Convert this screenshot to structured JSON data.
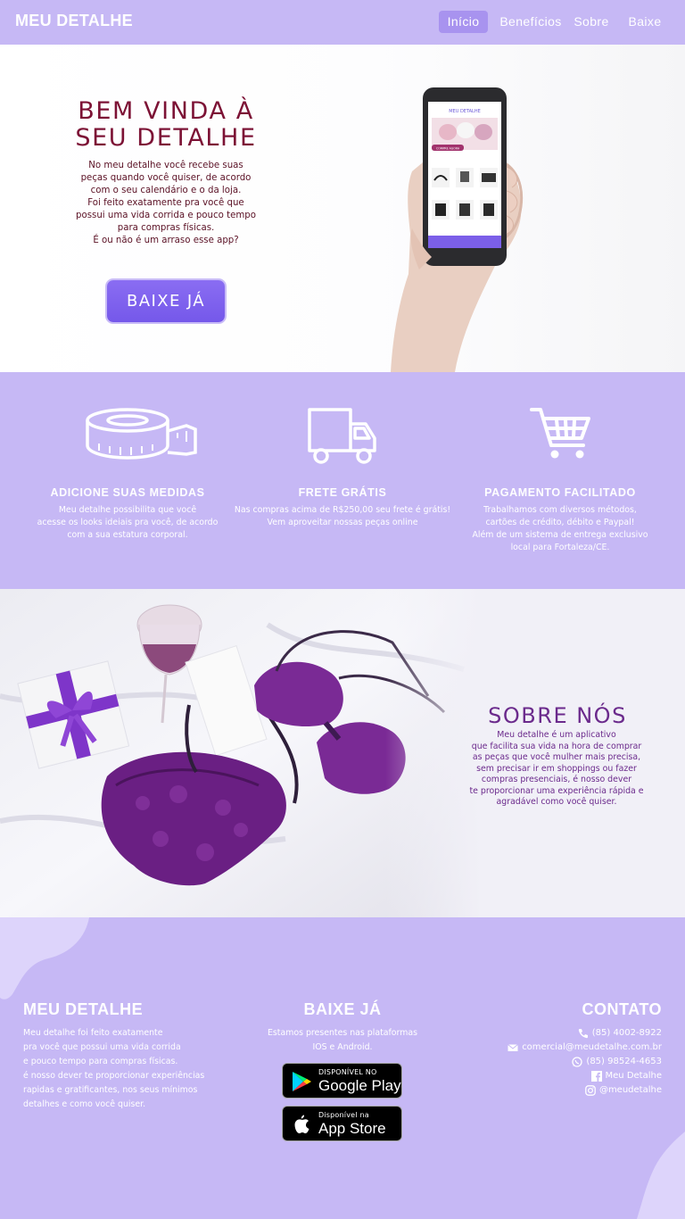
{
  "nav": {
    "brand": "MEU DETALHE",
    "links": [
      "Início",
      "Benefícios",
      "Sobre",
      "Baixe"
    ],
    "active_index": 0
  },
  "hero": {
    "title": "BEM VINDA À SEU DETALHE",
    "text_lines": [
      "No meu detalhe você recebe suas",
      "peças quando você quiser, de acordo",
      "com o seu calendário e o da loja.",
      "Foi feito exatamente pra você que",
      "possui uma vida corrida e pouco tempo",
      "para compras físicas.",
      "É ou não é um arraso esse app?"
    ],
    "cta": "BAIXE JÁ",
    "phone_screen": {
      "header": "MEU DETALHE",
      "banner_button": "COMPRE AGORA"
    }
  },
  "features": [
    {
      "icon": "measuring-tape-icon",
      "title": "ADICIONE SUAS MEDIDAS",
      "lines": [
        "Meu detalhe possibilita que você",
        "acesse os looks ideiais pra você, de acordo",
        "com a sua estatura corporal."
      ]
    },
    {
      "icon": "delivery-truck-icon",
      "title": "FRETE GRÁTIS",
      "lines": [
        "Nas compras acima de R$250,00 seu frete é grátis!",
        "Vem aproveitar nossas peças online"
      ]
    },
    {
      "icon": "shopping-cart-icon",
      "title": "PAGAMENTO FACILITADO",
      "lines": [
        "Trabalhamos com diversos métodos,",
        "cartões de crédito, débito e Paypal!",
        "Além de um sistema de entrega exclusivo",
        "local para Fortaleza/CE."
      ]
    }
  ],
  "about": {
    "title": "SOBRE NÓS",
    "lines": [
      "Meu detalhe é um aplicativo",
      "que facilita sua vida na hora de comprar",
      "as peças que você mulher mais precisa,",
      "sem precisar ir em shoppings ou fazer",
      "compras presenciais, é nosso dever",
      "te proporcionar uma experiência rápida e",
      "agradável como você quiser."
    ]
  },
  "footer": {
    "col1": {
      "title": "MEU DETALHE",
      "lines": [
        "Meu detalhe foi feito exatamente",
        "pra você que possui uma vida corrida",
        "e pouco tempo para compras físicas.",
        "é nosso dever te proporcionar experiências",
        "rapidas e gratificantes, nos seus mínimos",
        "detalhes e como você quiser."
      ]
    },
    "col2": {
      "title": "BAIXE JÁ",
      "lines": [
        "Estamos presentes nas plataformas",
        "IOS e Android."
      ],
      "google_play": {
        "small": "DISPONÍVEL NO",
        "big": "Google Play"
      },
      "app_store": {
        "small": "Disponível na",
        "big": "App Store"
      }
    },
    "col3": {
      "title": "CONTATO",
      "rows": [
        {
          "icon": "phone-icon",
          "text": "(85) 4002-8922"
        },
        {
          "icon": "mail-icon",
          "text": "comercial@meudetalhe.com.br"
        },
        {
          "icon": "whatsapp-icon",
          "text": "(85) 98524-4653"
        },
        {
          "icon": "facebook-icon",
          "text": "Meu Detalhe"
        },
        {
          "icon": "instagram-icon",
          "text": "@meudetalhe"
        }
      ]
    }
  },
  "colors": {
    "lavender": "#c6b8f5",
    "title_wine": "#7c1235",
    "purple_text": "#6b2a8c",
    "button": "#7558ea"
  }
}
